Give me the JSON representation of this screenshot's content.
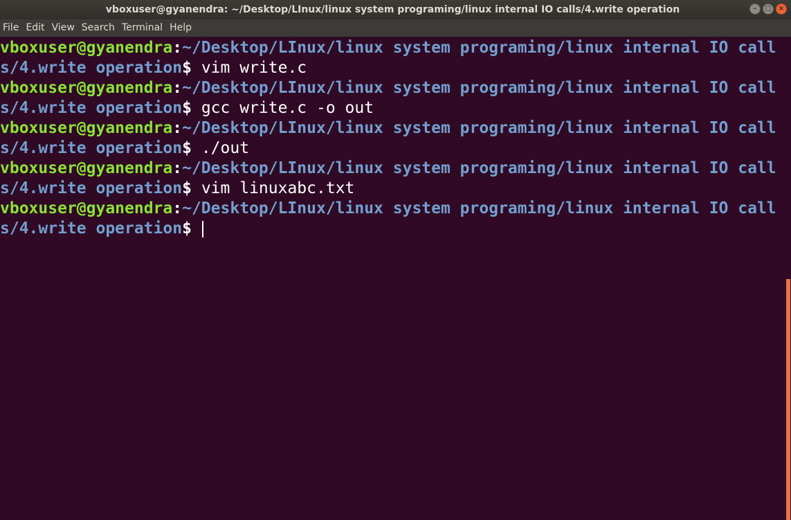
{
  "window": {
    "title": "vboxuser@gyanendra: ~/Desktop/LInux/linux system programing/linux internal IO calls/4.write operation",
    "controls": {
      "minimize_glyph": "–",
      "maximize_glyph": "□",
      "close_glyph": "×"
    }
  },
  "menu": {
    "items": [
      "File",
      "Edit",
      "View",
      "Search",
      "Terminal",
      "Help"
    ]
  },
  "terminal": {
    "colors": {
      "background": "#300a24",
      "user": "#8ae234",
      "path": "#729fcf",
      "text": "#ffffff"
    },
    "entries": [
      {
        "user": "vboxuser@gyanendra",
        "path_line1": "~/Desktop/LInux/linux system programing/linux internal IO call",
        "path_line2": "s/4.write operation",
        "command": "vim write.c"
      },
      {
        "user": "vboxuser@gyanendra",
        "path_line1": "~/Desktop/LInux/linux system programing/linux internal IO call",
        "path_line2": "s/4.write operation",
        "command": "gcc write.c -o out"
      },
      {
        "user": "vboxuser@gyanendra",
        "path_line1": "~/Desktop/LInux/linux system programing/linux internal IO call",
        "path_line2": "s/4.write operation",
        "command": "./out"
      },
      {
        "user": "vboxuser@gyanendra",
        "path_line1": "~/Desktop/LInux/linux system programing/linux internal IO call",
        "path_line2": "s/4.write operation",
        "command": "vim linuxabc.txt"
      },
      {
        "user": "vboxuser@gyanendra",
        "path_line1": "~/Desktop/LInux/linux system programing/linux internal IO call",
        "path_line2": "s/4.write operation",
        "command": ""
      }
    ],
    "prompt_colon": ":",
    "prompt_dollar": "$"
  }
}
